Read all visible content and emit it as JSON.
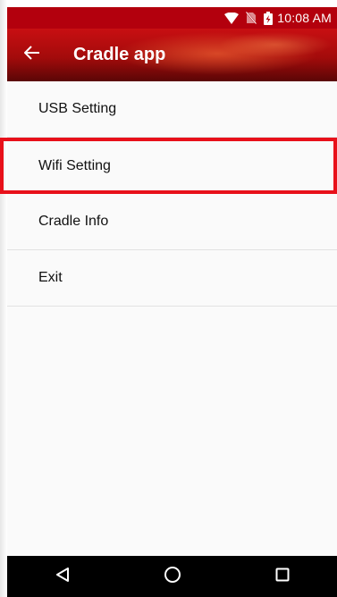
{
  "status_bar": {
    "time": "10:08 AM",
    "icons": [
      "wifi-icon",
      "no-sim-icon",
      "battery-charging-icon"
    ]
  },
  "app_bar": {
    "title": "Cradle app",
    "back_icon": "arrow-left-icon"
  },
  "menu": {
    "items": [
      {
        "label": "USB Setting"
      },
      {
        "label": "Wifi Setting"
      },
      {
        "label": "Cradle Info"
      },
      {
        "label": "Exit"
      }
    ],
    "highlighted_index": 1
  },
  "nav_bar": {
    "icons": [
      "back-triangle-icon",
      "home-circle-icon",
      "recents-square-icon"
    ]
  },
  "colors": {
    "status_bar": "#b3000d",
    "highlight": "#e8101a",
    "nav_bar": "#000000"
  }
}
